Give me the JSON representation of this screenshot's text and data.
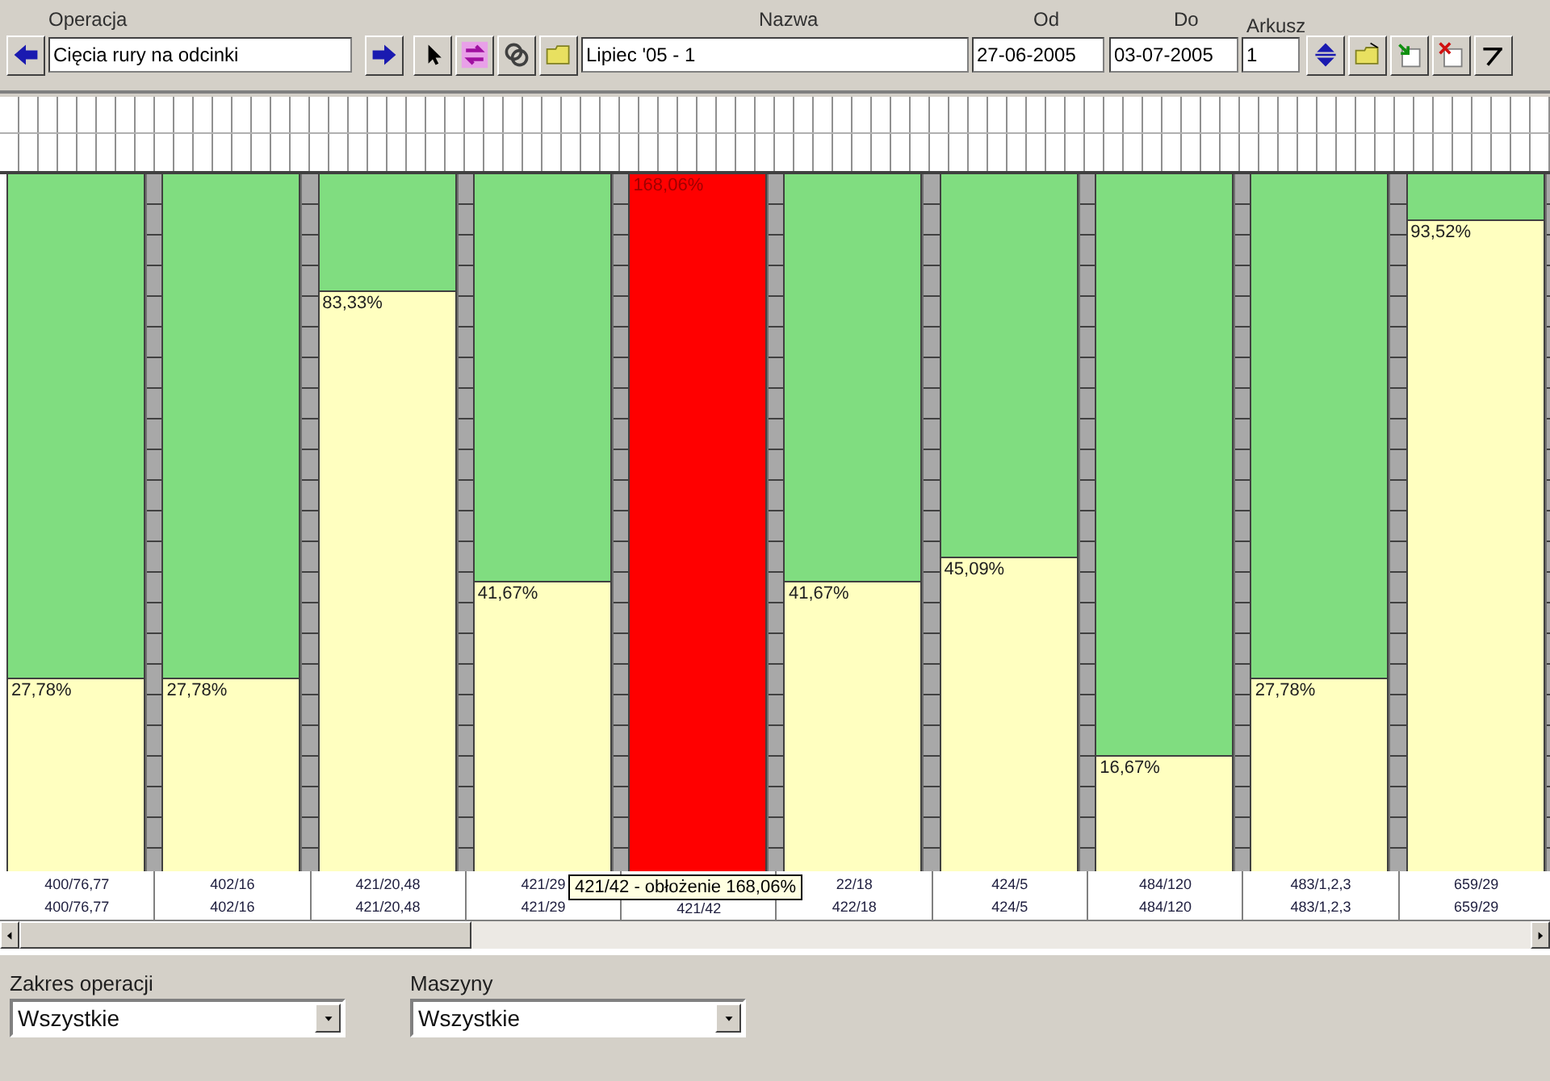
{
  "toolbar": {
    "operation": {
      "label": "Operacja",
      "value": "Cięcia rury na odcinki"
    },
    "name": {
      "label": "Nazwa",
      "value": "Lipiec '05 - 1"
    },
    "from": {
      "label": "Od",
      "value": "27-06-2005"
    },
    "to": {
      "label": "Do",
      "value": "03-07-2005"
    },
    "sheet": {
      "label": "Arkusz",
      "value": "1"
    }
  },
  "columns": [
    {
      "reading": "27,78%",
      "level": 0.2778,
      "overloaded": false,
      "labels": [
        "400/76,77",
        "400/76,77"
      ]
    },
    {
      "reading": "27,78%",
      "level": 0.2778,
      "overloaded": false,
      "labels": [
        "402/16",
        "402/16"
      ]
    },
    {
      "reading": "83,33%",
      "level": 0.8333,
      "overloaded": false,
      "labels": [
        "421/20,48",
        "421/20,48"
      ]
    },
    {
      "reading": "41,67%",
      "level": 0.4167,
      "overloaded": false,
      "labels": [
        "421/29",
        "421/29"
      ]
    },
    {
      "reading": "168,06%",
      "level": 1,
      "overloaded": true,
      "labels": [
        "421/42"
      ]
    },
    {
      "reading": "41,67%",
      "level": 0.4167,
      "overloaded": false,
      "labels": [
        "22/18",
        "422/18"
      ]
    },
    {
      "reading": "45,09%",
      "level": 0.4509,
      "overloaded": false,
      "labels": [
        "424/5",
        "424/5"
      ]
    },
    {
      "reading": "16,67%",
      "level": 0.1667,
      "overloaded": false,
      "labels": [
        "484/120",
        "484/120"
      ]
    },
    {
      "reading": "27,78%",
      "level": 0.2778,
      "overloaded": false,
      "labels": [
        "483/1,2,3",
        "483/1,2,3"
      ]
    },
    {
      "reading": "93,52%",
      "level": 0.9352,
      "overloaded": false,
      "labels": [
        "659/29",
        "659/29"
      ]
    }
  ],
  "tooltip": "421/42 - obłożenie 168,06%",
  "filters": [
    {
      "label": "Zakres operacji",
      "value": "Wszystkie"
    },
    {
      "label": "Maszyny",
      "value": "Wszystkie"
    }
  ]
}
